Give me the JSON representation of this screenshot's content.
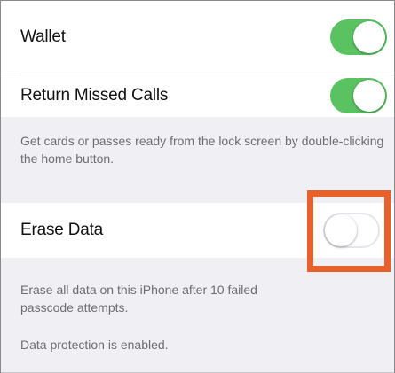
{
  "settings": {
    "wallet": {
      "label": "Wallet",
      "enabled": true
    },
    "return_missed_calls": {
      "label": "Return Missed Calls",
      "enabled": true
    },
    "wallet_footer": "Get cards or passes ready from the lock screen by double-clicking the home button.",
    "erase_data": {
      "label": "Erase Data",
      "enabled": false
    },
    "erase_footer": "Erase all data on this iPhone after 10 failed passcode attempts.",
    "protection_status": "Data protection is enabled."
  },
  "colors": {
    "toggle_on": "#5ac261",
    "highlight": "#e8602a",
    "group_background": "#efeff4"
  }
}
